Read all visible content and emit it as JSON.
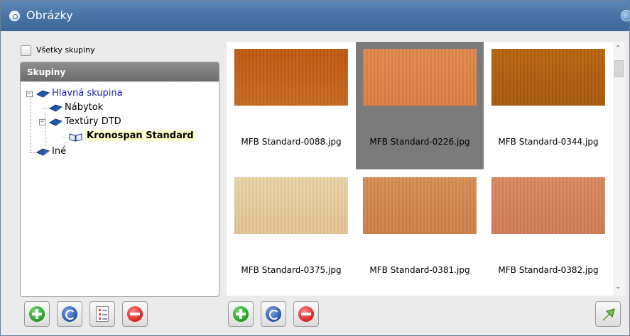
{
  "window": {
    "title": "Obrázky"
  },
  "left_panel": {
    "all_groups_label": "Všetky skupiny",
    "all_groups_checked": false,
    "tree_header": "Skupiny",
    "tree": [
      {
        "label": "Hlavná skupina",
        "level": 0,
        "expander": "−",
        "color": "#1a1aa8",
        "bold": false,
        "selected": false
      },
      {
        "label": "Nábytok",
        "level": 1,
        "expander": "",
        "color": "#000000",
        "bold": false,
        "selected": false
      },
      {
        "label": "Textúry DTD",
        "level": 1,
        "expander": "−",
        "color": "#000000",
        "bold": false,
        "selected": false
      },
      {
        "label": "Kronospan Standard",
        "level": 2,
        "expander": "",
        "color": "#000000",
        "bold": true,
        "selected": true
      },
      {
        "label": "Iné",
        "level": 0,
        "expander": "",
        "color": "#000000",
        "bold": false,
        "selected": false
      }
    ],
    "buttons": [
      "plus-icon",
      "refresh-icon",
      "list-icon",
      "minus-icon"
    ]
  },
  "gallery": {
    "items": [
      {
        "caption": "MFB Standard-0088.jpg",
        "color_top": "#c0580f",
        "color_bottom": "#c86a1f",
        "selected": false
      },
      {
        "caption": "MFB Standard-0226.jpg",
        "color_top": "#e2884e",
        "color_bottom": "#dd7e45",
        "selected": true
      },
      {
        "caption": "MFB Standard-0344.jpg",
        "color_top": "#b8650f",
        "color_bottom": "#a85a0e",
        "selected": false
      },
      {
        "caption": "MFB Standard-0375.jpg",
        "color_top": "#ebd3a6",
        "color_bottom": "#e4c493",
        "selected": false
      },
      {
        "caption": "MFB Standard-0381.jpg",
        "color_top": "#d88e56",
        "color_bottom": "#cd8048",
        "selected": false
      },
      {
        "caption": "MFB Standard-0382.jpg",
        "color_top": "#d98a61",
        "color_bottom": "#cf7c54",
        "selected": false
      }
    ],
    "buttons": [
      "plus-icon",
      "refresh-icon",
      "minus-icon"
    ],
    "export_button": "export-arrow-icon"
  },
  "colors": {
    "titlebar": "#4a75a6",
    "selection": "#7b7b7b",
    "tree_selected_bg": "#ffffcc"
  }
}
